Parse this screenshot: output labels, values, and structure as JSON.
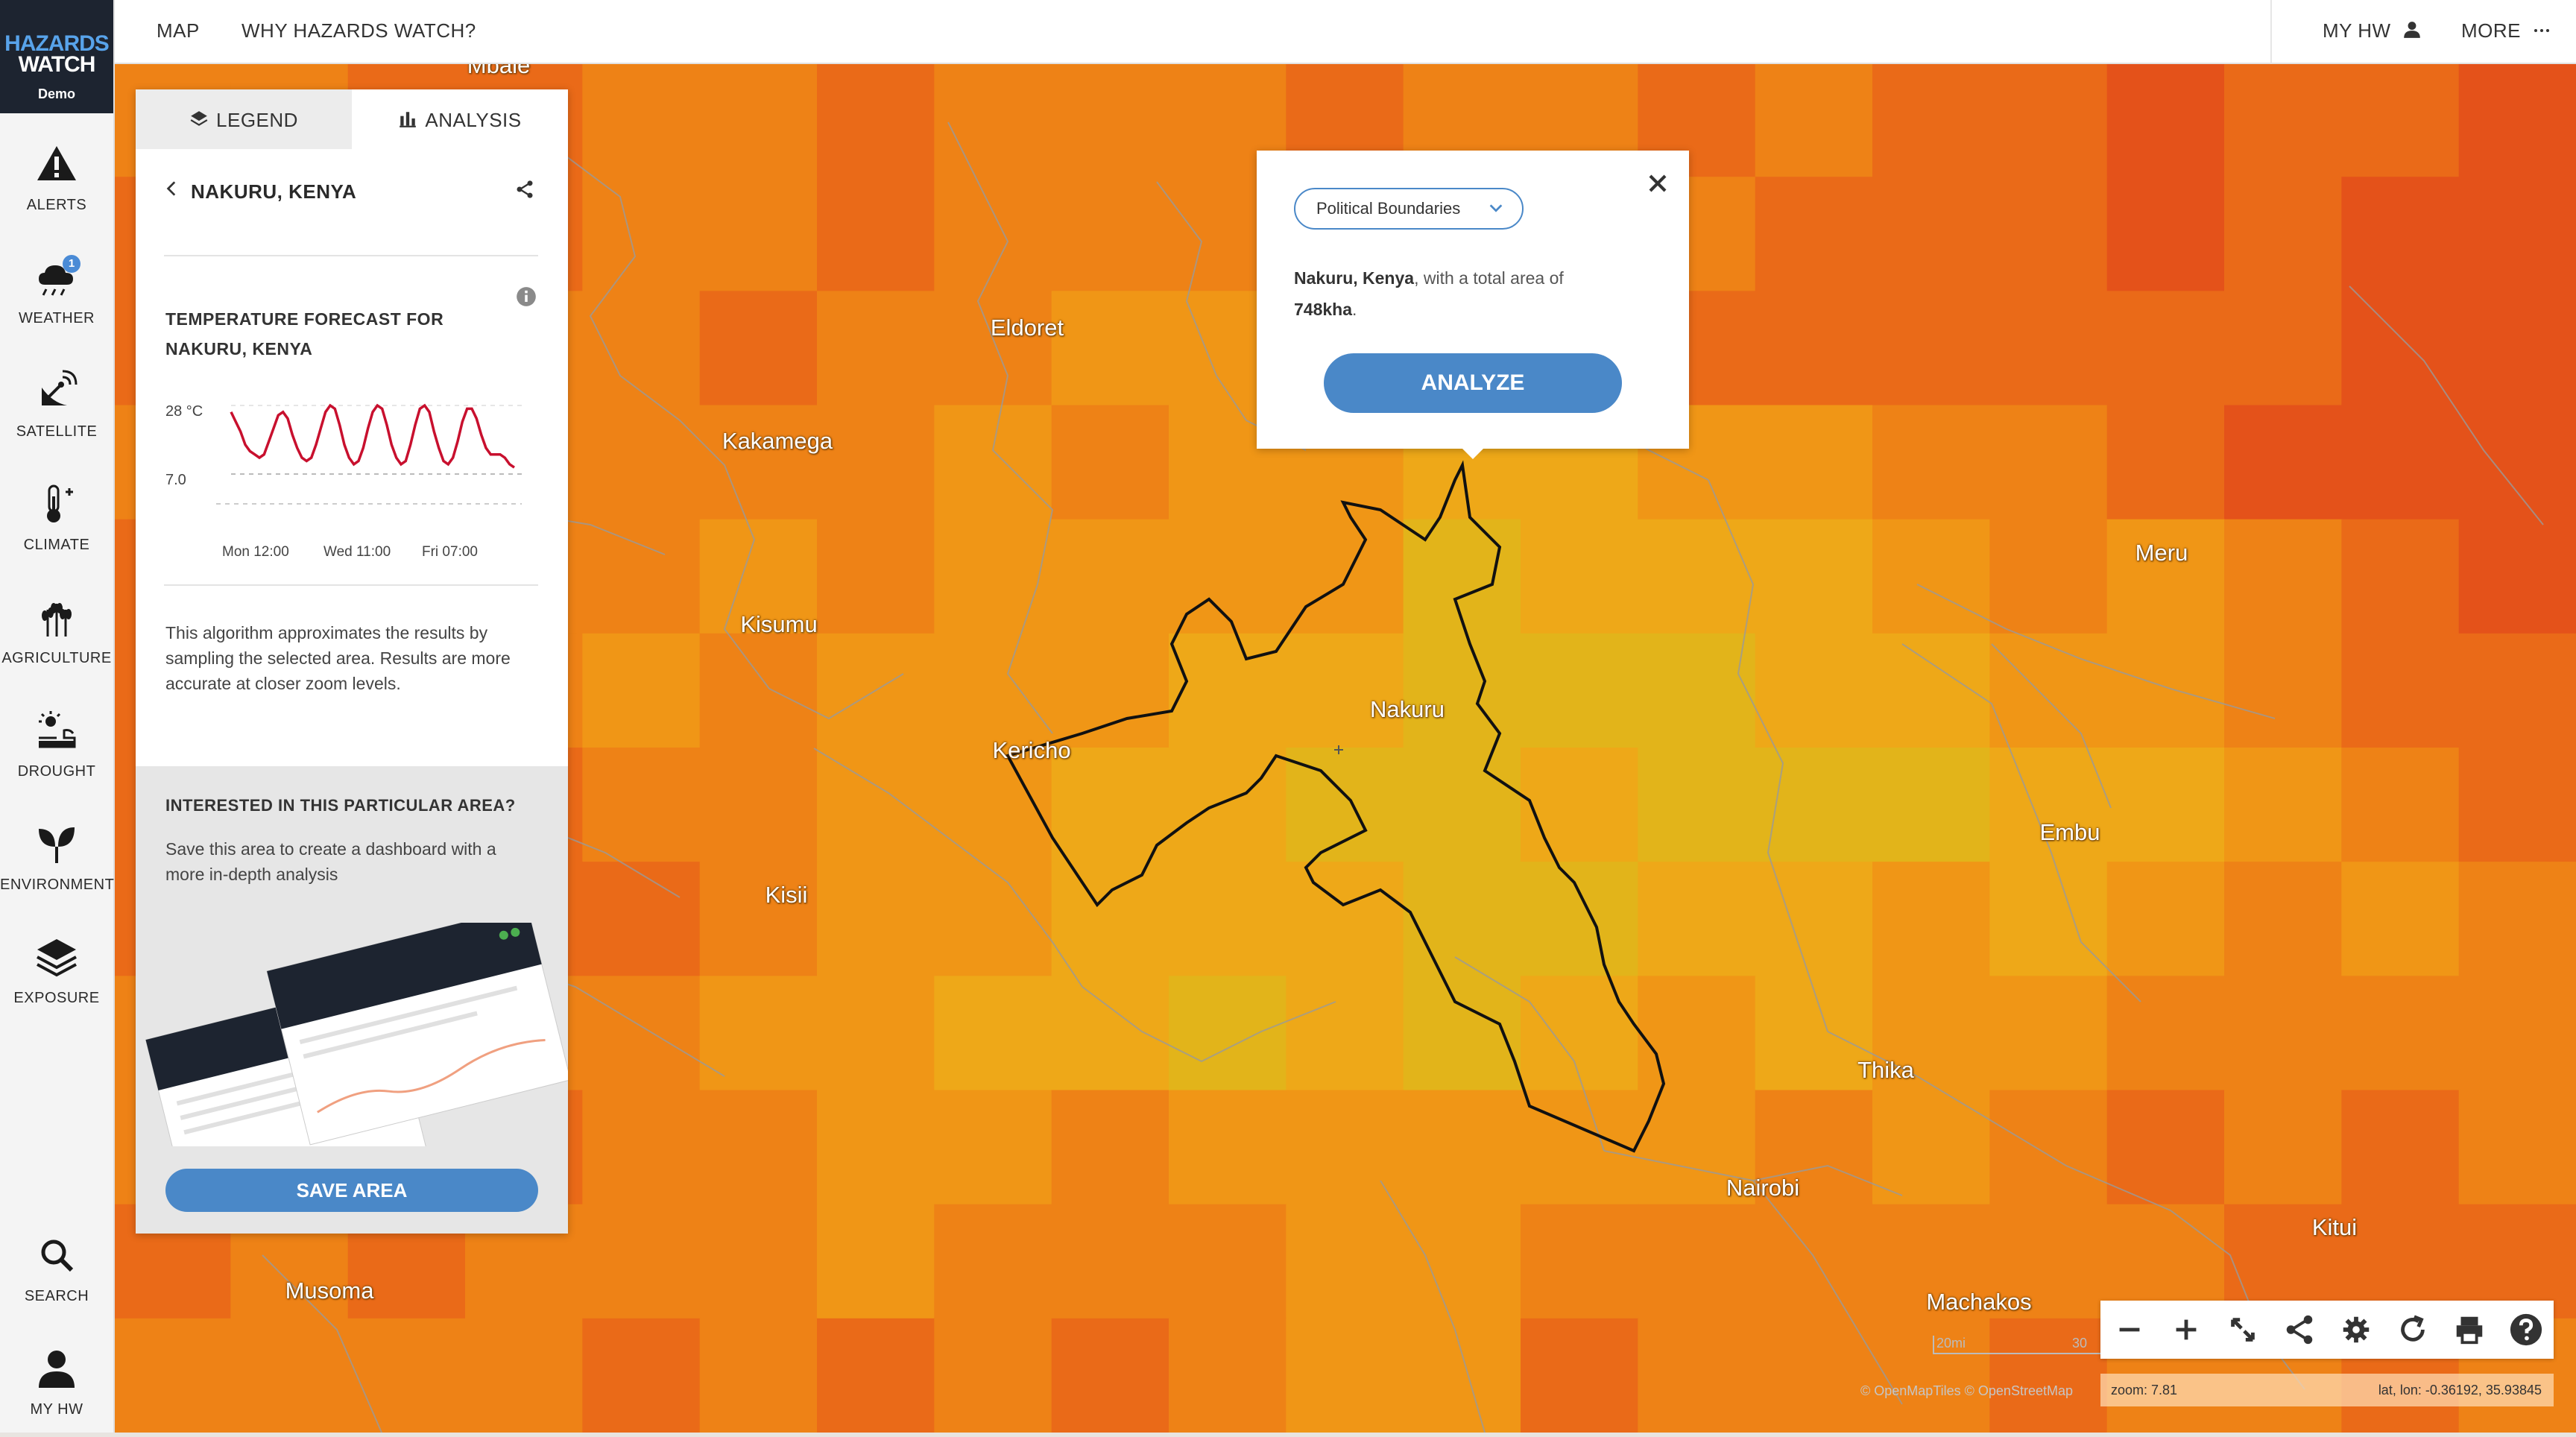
{
  "brand": {
    "line1": "HAZARDS",
    "line2": "WATCH",
    "sub": "Demo"
  },
  "nav": {
    "items": [
      {
        "label": "Alerts",
        "icon": "alert-icon"
      },
      {
        "label": "Weather",
        "icon": "weather-icon",
        "badge": "1"
      },
      {
        "label": "Satellite",
        "icon": "satellite-icon"
      },
      {
        "label": "Climate",
        "icon": "thermometer-icon"
      },
      {
        "label": "Agriculture",
        "icon": "wheat-icon"
      },
      {
        "label": "Drought",
        "icon": "drought-icon"
      },
      {
        "label": "Environment",
        "icon": "leaf-icon"
      },
      {
        "label": "Exposure",
        "icon": "layers-icon"
      }
    ],
    "search": "Search",
    "myhw": "My HW"
  },
  "topbar": {
    "map": "MAP",
    "why": "WHY HAZARDS WATCH?",
    "myhw": "MY HW",
    "more": "MORE"
  },
  "panel": {
    "tabs": [
      {
        "label": "LEGEND",
        "icon": "layers-icon"
      },
      {
        "label": "ANALYSIS",
        "icon": "bar-chart-icon"
      }
    ],
    "location": "NAKURU, KENYA",
    "forecast_title": "TEMPERATURE FORECAST FOR NAKURU, KENYA",
    "description": "This algorithm approximates the results by sampling the selected area. Results are more accurate at closer zoom levels.",
    "cta_title": "INTERESTED IN THIS PARTICULAR AREA?",
    "cta_text": "Save this area to create a dashboard with a more in-depth analysis",
    "save_label": "SAVE AREA"
  },
  "chart_data": {
    "type": "line",
    "ytick_labels": [
      "28 °C",
      "7.0"
    ],
    "yticks": [
      28,
      7
    ],
    "ylim": [
      0,
      32
    ],
    "xtick_labels": [
      "Mon 12:00",
      "Wed 11:00",
      "Fri 07:00"
    ],
    "x": [
      0,
      1,
      2,
      3,
      4,
      5,
      6,
      7,
      8,
      9,
      10,
      11,
      12,
      13,
      14,
      15,
      16,
      17,
      18,
      19,
      20,
      21,
      22,
      23,
      24,
      25,
      26,
      27,
      28,
      29,
      30,
      31,
      32,
      33,
      34,
      35,
      36,
      37,
      38,
      39,
      40,
      41,
      42,
      43,
      44,
      45,
      46,
      47,
      48,
      49,
      50,
      51,
      52,
      53,
      54,
      55,
      56,
      57,
      58,
      59,
      60
    ],
    "series": [
      {
        "values": [
          26,
          23,
          20,
          16,
          14,
          13,
          12,
          13,
          17,
          21,
          25,
          26,
          24,
          19,
          15,
          12,
          11,
          12,
          16,
          21,
          26,
          28,
          27,
          22,
          16,
          12,
          10,
          11,
          15,
          21,
          26,
          28,
          27,
          22,
          16,
          12,
          10,
          11,
          16,
          22,
          27,
          28,
          26,
          20,
          15,
          11,
          10,
          12,
          17,
          23,
          27,
          27,
          24,
          19,
          15,
          13,
          13,
          13,
          12,
          10,
          9
        ],
        "color": "#c8102e"
      }
    ]
  },
  "popup": {
    "dropdown": "Political Boundaries",
    "place": "Nakuru, Kenya",
    "text": ", with a total area of",
    "area": "748kha",
    "button": "ANALYZE"
  },
  "map": {
    "cities": [
      "Mbale",
      "Eldoret",
      "Kakamega",
      "Kisumu",
      "Kericho",
      "Nakuru",
      "Kisii",
      "Meru",
      "Embu",
      "Thika",
      "Nairobi",
      "Kitui",
      "Machakos",
      "Musoma"
    ],
    "attribution": "© OpenMapTiles   © OpenStreetMap",
    "scale": [
      "20mi",
      "30"
    ],
    "zoom": "zoom: 7.81",
    "latlon": "lat, lon: -0.36192, 35.93845"
  },
  "tools": [
    "zoom-out-icon",
    "zoom-in-icon",
    "fullscreen-icon",
    "share-icon",
    "settings-icon",
    "refresh-icon",
    "print-icon",
    "help-icon"
  ]
}
